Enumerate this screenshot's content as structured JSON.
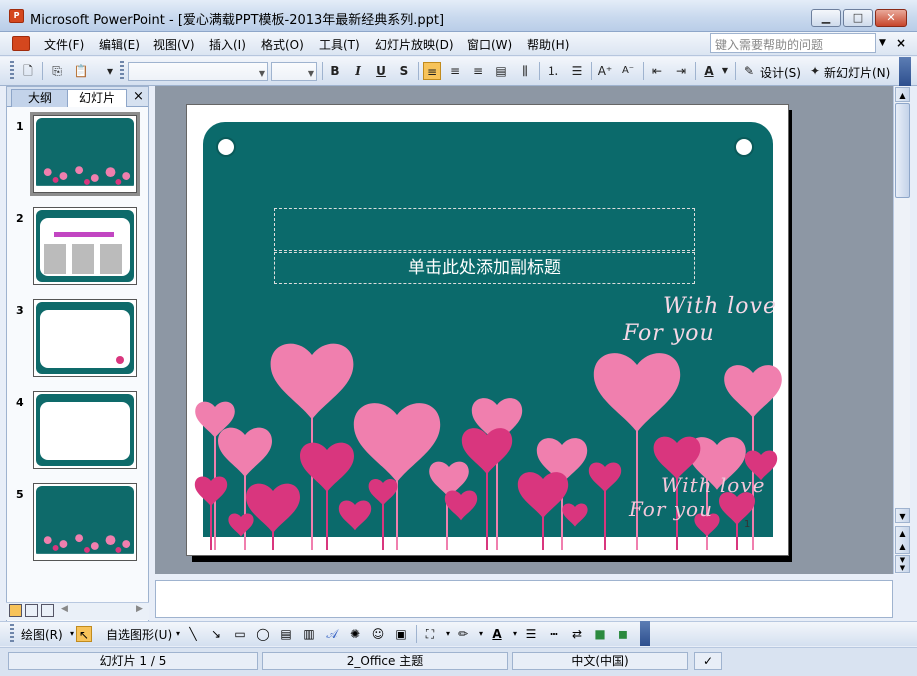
{
  "window": {
    "title": "Microsoft PowerPoint - [爱心满载PPT模板-2013年最新经典系列.ppt]",
    "app_icon_text": "P",
    "minimize": "▁",
    "maximize": "□",
    "close": "✕"
  },
  "menu": {
    "items": [
      "文件(F)",
      "编辑(E)",
      "视图(V)",
      "插入(I)",
      "格式(O)",
      "工具(T)",
      "幻灯片放映(D)",
      "窗口(W)",
      "帮助(H)"
    ],
    "help_placeholder": "键入需要帮助的问题",
    "close": "×"
  },
  "toolbar": {
    "font_name": "",
    "font_size": "",
    "bold": "B",
    "italic": "I",
    "underline": "U",
    "shadow": "S",
    "design_label": "设计(S)",
    "new_slide_label": "新幻灯片(N)"
  },
  "left_pane": {
    "tabs": [
      "大纲",
      "幻灯片"
    ],
    "close": "×",
    "thumbnails": [
      {
        "num": "1",
        "selected": true
      },
      {
        "num": "2",
        "selected": false
      },
      {
        "num": "3",
        "selected": false
      },
      {
        "num": "4",
        "selected": false
      },
      {
        "num": "5",
        "selected": false
      }
    ]
  },
  "slide": {
    "subtitle_placeholder": "单击此处添加副标题",
    "script_line1": "With love",
    "script_line2": "For you",
    "script_line3": "With love",
    "script_line4": "For you",
    "number": "1"
  },
  "drawbar": {
    "draw_label": "绘图(R)",
    "autoshape_label": "自选图形(U)"
  },
  "status": {
    "slide_info": "幻灯片 1 / 5",
    "theme": "2_Office 主题",
    "language": "中文(中国)"
  },
  "colors": {
    "board": "#0b6a6b",
    "heart_light": "#f07fae",
    "heart_dark": "#d9367e"
  }
}
